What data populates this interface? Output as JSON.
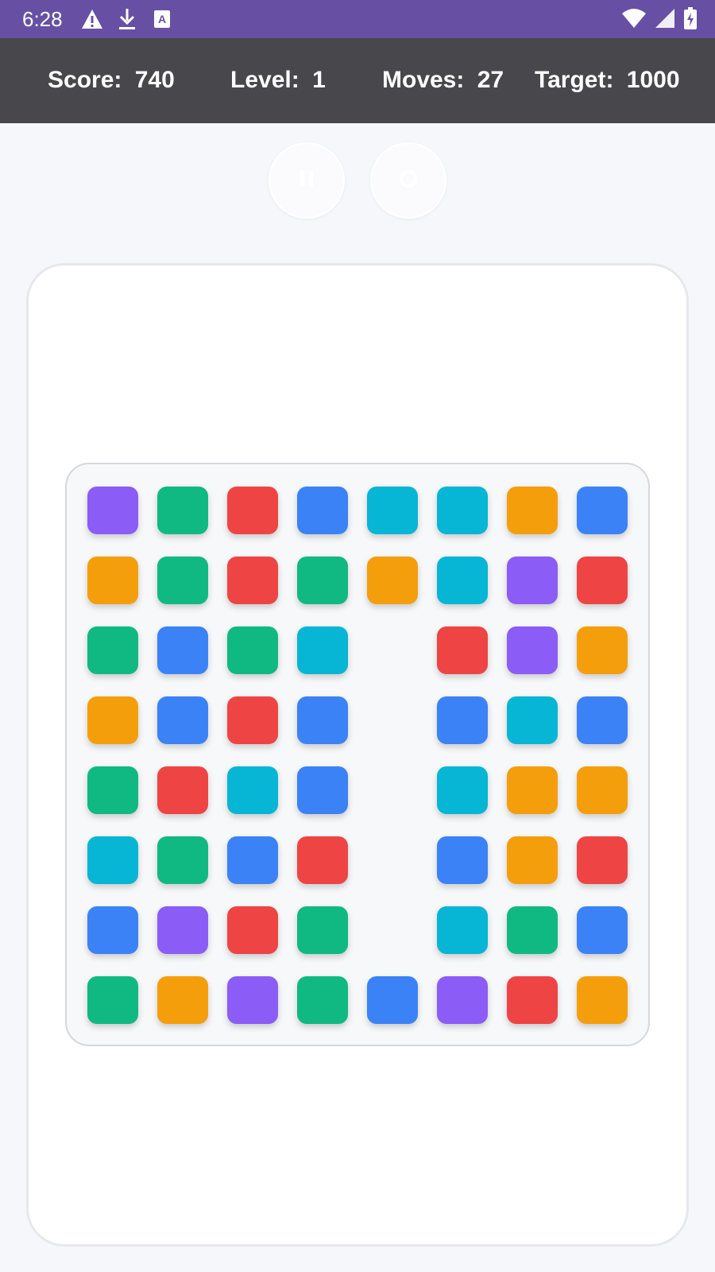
{
  "status_bar": {
    "time": "6:28",
    "icons": [
      "warning-icon",
      "download-icon",
      "font-icon"
    ],
    "right_icons": [
      "wifi-icon",
      "signal-icon",
      "battery-icon"
    ]
  },
  "hud": {
    "score_label": "Score:",
    "score_value": "740",
    "level_label": "Level:",
    "level_value": "1",
    "moves_label": "Moves:",
    "moves_value": "27",
    "target_label": "Target:",
    "target_value": "1000"
  },
  "controls": {
    "pause_icon": "pause-icon",
    "restart_icon": "restart-icon"
  },
  "colors": {
    "purple": "#8b5cf6",
    "green": "#10b981",
    "red": "#ef4444",
    "blue": "#3b82f6",
    "cyan": "#06b6d4",
    "orange": "#f59e0b"
  },
  "board": {
    "rows": [
      [
        "purple",
        "green",
        "red",
        "blue",
        "cyan",
        "cyan",
        "orange",
        "blue"
      ],
      [
        "orange",
        "green",
        "red",
        "green",
        "orange",
        "cyan",
        "purple",
        "red"
      ],
      [
        "green",
        "blue",
        "green",
        "cyan",
        null,
        "red",
        "purple",
        "orange"
      ],
      [
        "orange",
        "blue",
        "red",
        "blue",
        null,
        "blue",
        "cyan",
        "blue"
      ],
      [
        "green",
        "red",
        "cyan",
        "blue",
        null,
        "cyan",
        "orange",
        "orange"
      ],
      [
        "cyan",
        "green",
        "blue",
        "red",
        null,
        "blue",
        "orange",
        "red"
      ],
      [
        "blue",
        "purple",
        "red",
        "green",
        null,
        "cyan",
        "green",
        "blue"
      ],
      [
        "green",
        "orange",
        "purple",
        "green",
        "blue",
        "purple",
        "red",
        "orange"
      ]
    ]
  }
}
